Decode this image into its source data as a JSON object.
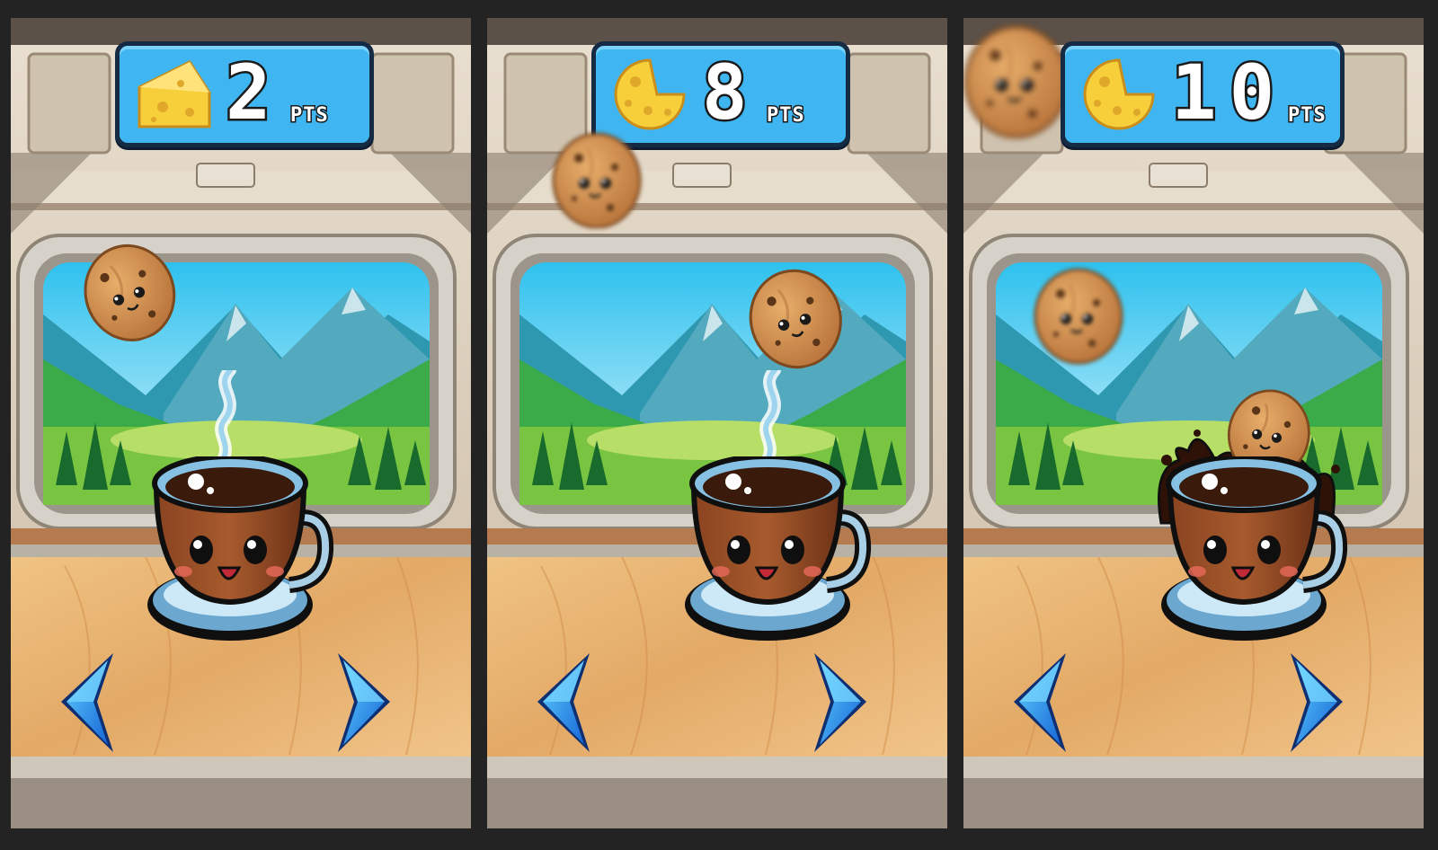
{
  "game": {
    "frames": [
      {
        "score": "2",
        "unit": "PTS"
      },
      {
        "score": "8",
        "unit": "PTS"
      },
      {
        "score": "10",
        "unit": "PTS"
      }
    ]
  },
  "icons": {
    "score_icon": "cheese-icon",
    "left_button": "left-arrow-icon",
    "right_button": "right-arrow-icon",
    "player": "coffee-cup-character",
    "falling_item": "cookie-character"
  },
  "colors": {
    "hud_blue": "#3fb6f1",
    "arrow_blue": "#1f8be8",
    "cheese_yellow": "#f7cf3a",
    "coffee_brown": "#7a3b1c",
    "table_wood": "#e7b26e",
    "sky": "#9fe1f7"
  }
}
